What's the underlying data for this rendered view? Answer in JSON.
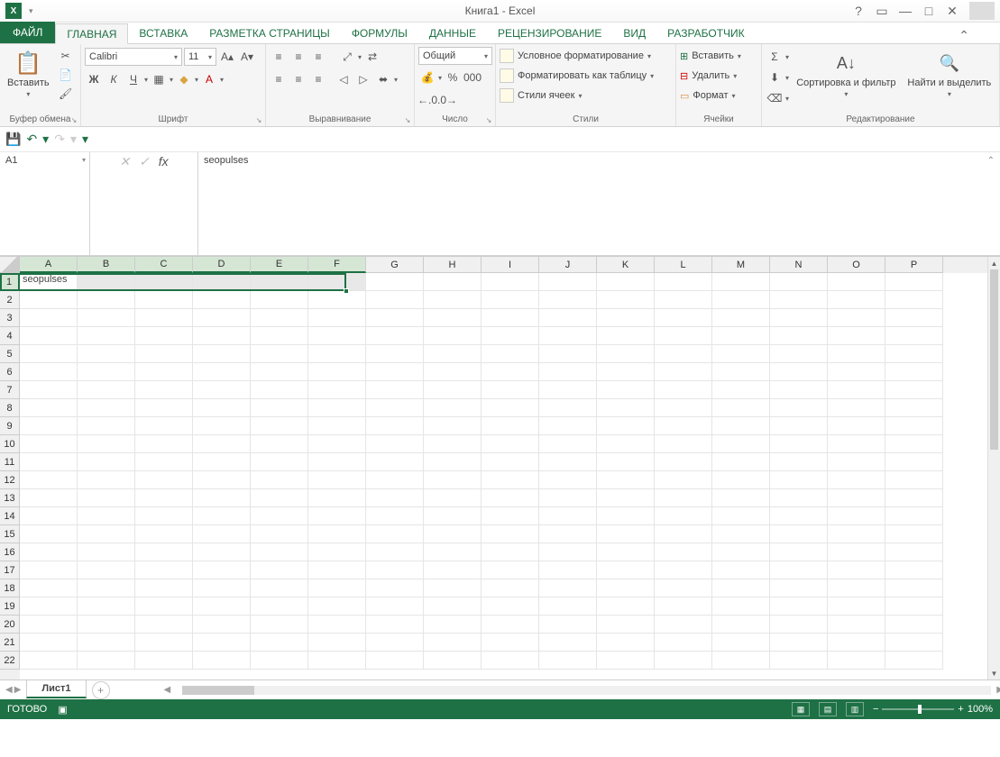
{
  "title": "Книга1 - Excel",
  "menutabs": {
    "file": "ФАЙЛ",
    "items": [
      "ГЛАВНАЯ",
      "ВСТАВКА",
      "РАЗМЕТКА СТРАНИЦЫ",
      "ФОРМУЛЫ",
      "ДАННЫЕ",
      "РЕЦЕНЗИРОВАНИЕ",
      "ВИД",
      "РАЗРАБОТЧИК"
    ],
    "active": 0
  },
  "ribbon": {
    "clipboard": {
      "paste": "Вставить",
      "label": "Буфер обмена"
    },
    "font": {
      "name": "Calibri",
      "size": "11",
      "label": "Шрифт"
    },
    "alignment": {
      "label": "Выравнивание"
    },
    "number": {
      "format": "Общий",
      "label": "Число"
    },
    "styles": {
      "cond": "Условное форматирование",
      "table": "Форматировать как таблицу",
      "cell": "Стили ячеек",
      "label": "Стили"
    },
    "cells": {
      "insert": "Вставить",
      "delete": "Удалить",
      "format": "Формат",
      "label": "Ячейки"
    },
    "editing": {
      "sort": "Сортировка и фильтр",
      "find": "Найти и выделить",
      "label": "Редактирование"
    }
  },
  "namebox": "A1",
  "formula": "seopulses",
  "columns": [
    "A",
    "B",
    "C",
    "D",
    "E",
    "F",
    "G",
    "H",
    "I",
    "J",
    "K",
    "L",
    "M",
    "N",
    "O",
    "P"
  ],
  "selected_cols": [
    "A",
    "B",
    "C",
    "D",
    "E",
    "F"
  ],
  "rows": 22,
  "selected_row": 1,
  "celldata": {
    "A1": "seopulses"
  },
  "sheet": {
    "name": "Лист1"
  },
  "status": {
    "ready": "ГОТОВО",
    "zoom": "100%"
  }
}
